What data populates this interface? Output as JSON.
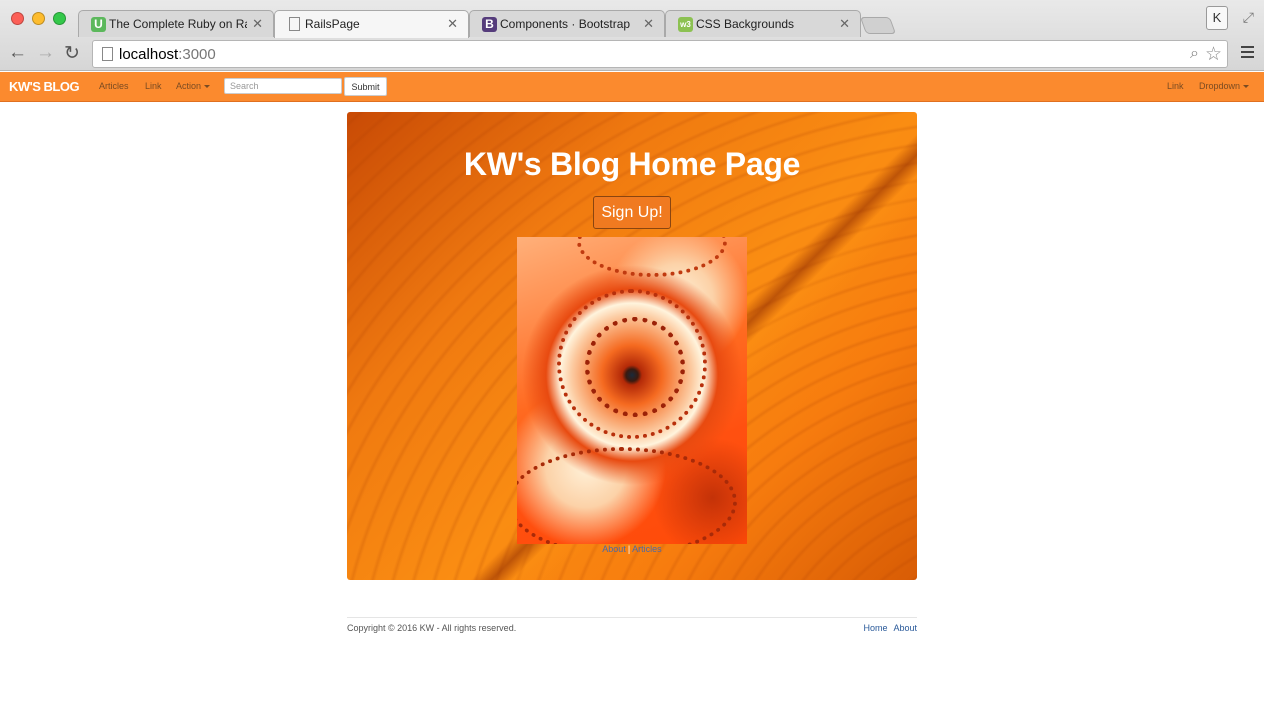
{
  "browser": {
    "tabs": [
      {
        "title": "The Complete Ruby on Rai",
        "favicon": "U",
        "favicon_color": "#5cb85c"
      },
      {
        "title": "RailsPage",
        "favicon": "",
        "favicon_color": "",
        "active": true
      },
      {
        "title": "Components · Bootstrap",
        "favicon": "B",
        "favicon_color": "#563d7c"
      },
      {
        "title": "CSS Backgrounds",
        "favicon": "w3",
        "favicon_color": "#8cc152"
      }
    ],
    "close_glyph": "✕",
    "profile_initial": "K",
    "url_host": "localhost",
    "url_port": ":3000"
  },
  "navbar": {
    "brand": "KW'S BLOG",
    "links": [
      "Articles",
      "Link",
      "Action"
    ],
    "search_placeholder": "Search",
    "submit_label": "Submit",
    "right_links": [
      "Link",
      "Dropdown"
    ],
    "bg_color": "#fb8a2e"
  },
  "hero": {
    "title": "KW's Blog Home Page",
    "signup_label": "Sign Up!",
    "link_about": "About",
    "link_separator": "|",
    "link_articles": "Articles"
  },
  "footer": {
    "copyright": "Copyright © 2016 KW - All rights reserved.",
    "links": [
      "Home",
      "About"
    ]
  }
}
